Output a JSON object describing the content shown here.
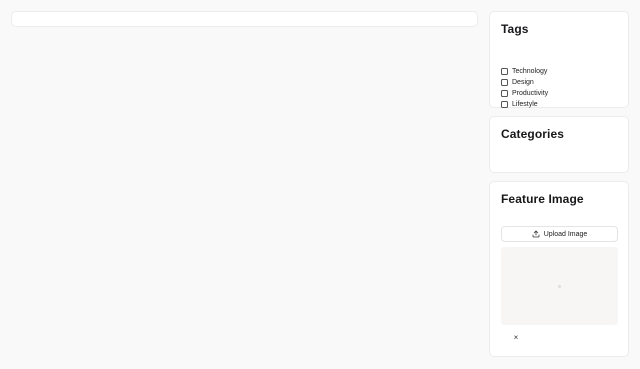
{
  "tags": {
    "title": "Tags",
    "items": [
      {
        "label": "Technology",
        "checked": false
      },
      {
        "label": "Design",
        "checked": false
      },
      {
        "label": "Productivity",
        "checked": false
      },
      {
        "label": "Lifestyle",
        "checked": false
      }
    ]
  },
  "categories": {
    "title": "Categories"
  },
  "feature_image": {
    "title": "Feature Image",
    "upload_label": "Upload Image",
    "upload_icon": "upload-icon",
    "remove_label": "×"
  }
}
